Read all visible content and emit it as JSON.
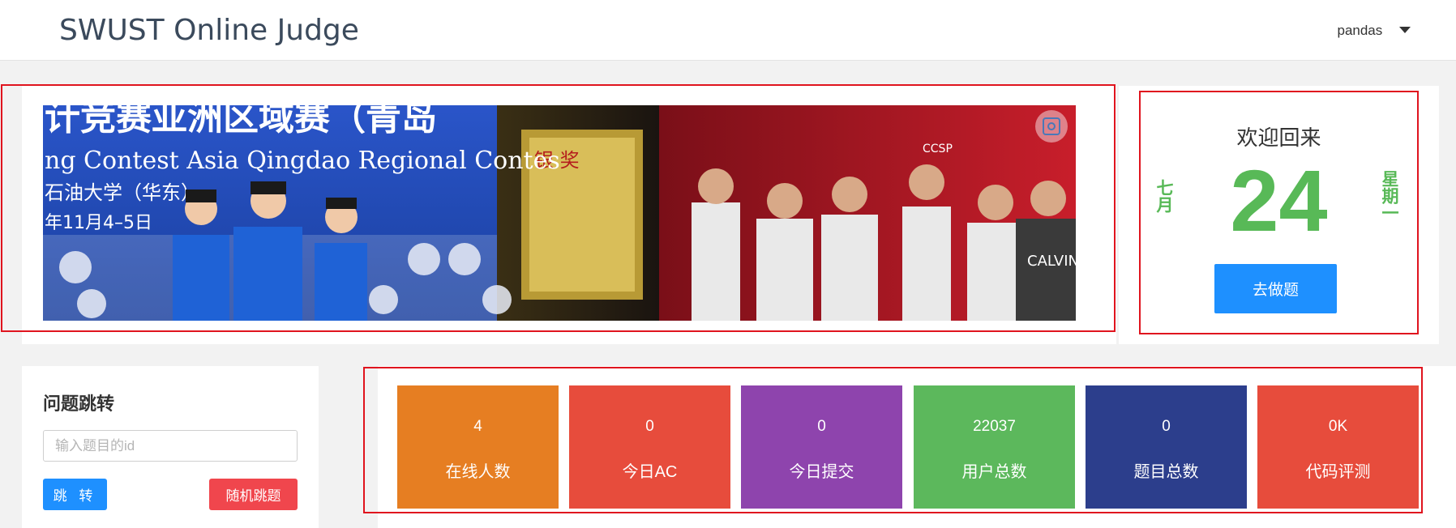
{
  "header": {
    "brand": "SWUST Online Judge",
    "user": "pandas"
  },
  "banner": {
    "line1": "计竞赛亚洲区域赛（青岛",
    "line2": "ng Contest Asia Qingdao Regional Contes",
    "line3": "石油大学（华东）",
    "line4": "年11月4–5日",
    "plaque": "银 奖",
    "ccsp": "CCSP",
    "calvin": "CALVIN",
    "icon": "screenshot-icon"
  },
  "welcome": {
    "title": "欢迎回来",
    "day": "24",
    "month": "七月",
    "weekday": "星期一",
    "button": "去做题"
  },
  "jump": {
    "title": "问题跳转",
    "placeholder": "输入题目的id",
    "jump_button": "跳 转",
    "random_button": "随机跳题"
  },
  "stats": [
    {
      "value": "4",
      "label": "在线人数",
      "color": "#e67e22"
    },
    {
      "value": "0",
      "label": "今日AC",
      "color": "#e74c3c"
    },
    {
      "value": "0",
      "label": "今日提交",
      "color": "#8e44ad"
    },
    {
      "value": "22037",
      "label": "用户总数",
      "color": "#5cb85c"
    },
    {
      "value": "0",
      "label": "题目总数",
      "color": "#2c3e8c"
    },
    {
      "value": "0K",
      "label": "代码评测",
      "color": "#e74c3c"
    }
  ],
  "colors": {
    "accent": "#1e90ff",
    "green": "#58b957",
    "danger": "#f0464d",
    "highlight": "#e0141e"
  }
}
